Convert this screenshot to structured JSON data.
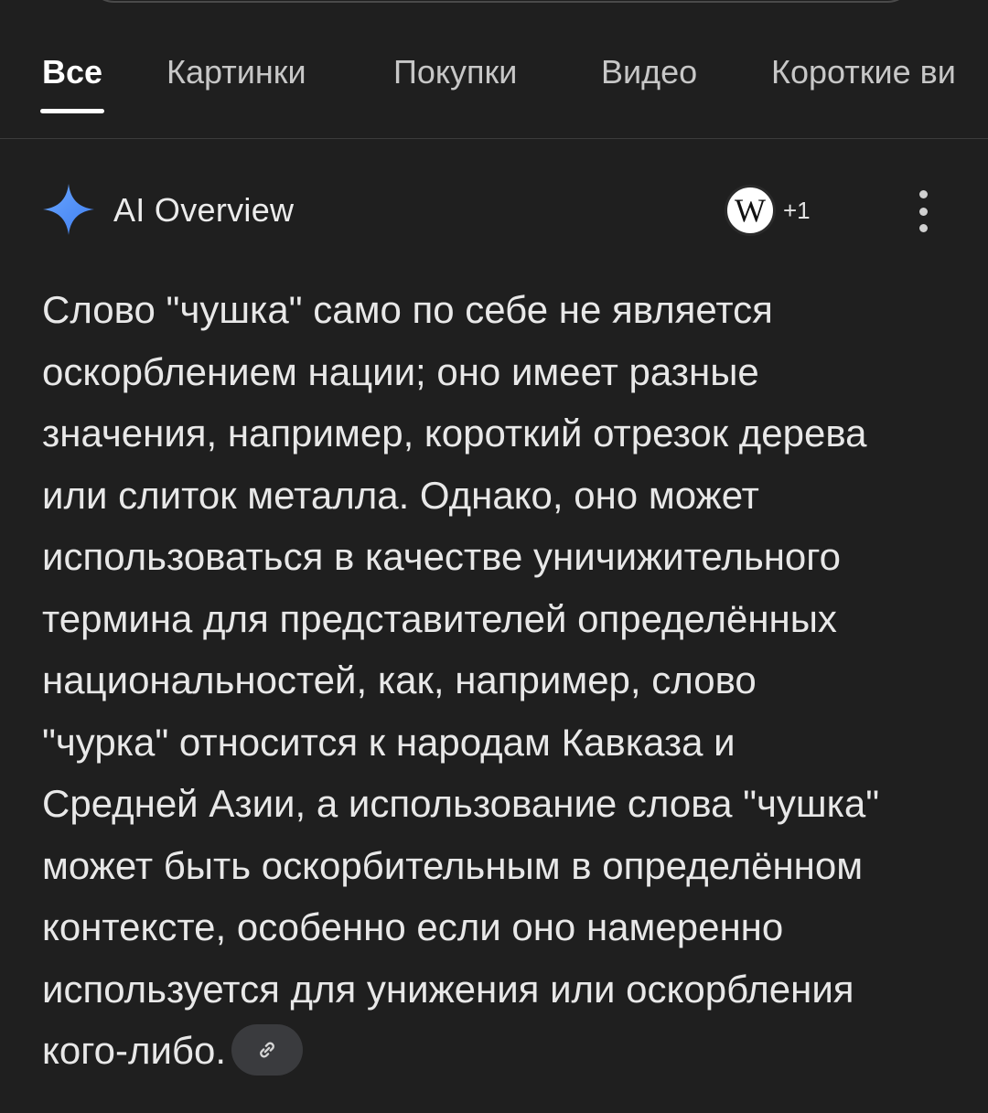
{
  "tabs": [
    {
      "label": "Все",
      "active": true
    },
    {
      "label": "Картинки",
      "active": false
    },
    {
      "label": "Покупки",
      "active": false
    },
    {
      "label": "Видео",
      "active": false
    },
    {
      "label": "Короткие ви",
      "active": false
    }
  ],
  "ai_overview": {
    "title": "AI Overview",
    "source_icon": "wikipedia-icon",
    "source_icon_letter": "W",
    "source_extra_count": "+1",
    "more_icon": "more-vertical-icon",
    "link_icon": "link-icon",
    "text_lines": [
      "Слово \"чушка\" само по себе не является",
      "оскорблением нации; оно имеет разные",
      "значения, например, короткий отрезок дерева",
      "или слиток металла. Однако, оно может",
      "использоваться в качестве уничижительного",
      "термина для представителей определённых",
      "национальностей, как, например, слово",
      "\"чурка\" относится к народам Кавказа и",
      "Средней Азии, а использование слова \"чушка\"",
      "может быть оскорбительным в определённом",
      "контексте, особенно если оно намеренно",
      "используется для унижения или оскорбления",
      "кого-либо."
    ]
  },
  "colors": {
    "background": "#1f1f1f",
    "sparkle_blue": "#4f8ff7",
    "text": "#e8e8e8",
    "link_chip": "#3a3b3e"
  }
}
